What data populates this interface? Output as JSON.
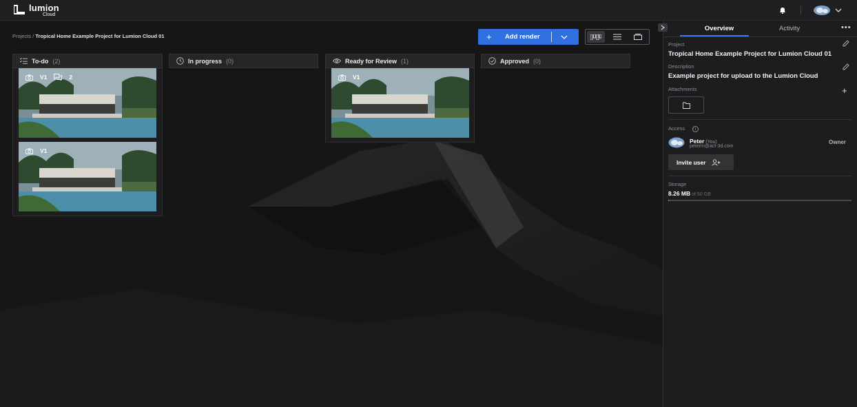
{
  "app": {
    "logo_text": "lumion",
    "logo_sub": "Cloud"
  },
  "breadcrumb": {
    "root": "Projects",
    "separator": "/",
    "current": "Tropical Home Example Project for Lumion Cloud 01"
  },
  "toolbar": {
    "add_render_label": "Add render",
    "add_render_color": "#2f6fe0",
    "view_modes": [
      "kanban",
      "list",
      "cards"
    ],
    "active_view": "kanban"
  },
  "board": {
    "columns": [
      {
        "label": "To-do",
        "count": "(2)",
        "icon": "checklist-icon",
        "cards": [
          {
            "version": "V1",
            "comments": "2"
          },
          {
            "version": "V1",
            "comments": ""
          }
        ]
      },
      {
        "label": "In progress",
        "count": "(0)",
        "icon": "clock-icon",
        "cards": []
      },
      {
        "label": "Ready for Review",
        "count": "(1)",
        "icon": "eye-icon",
        "cards": [
          {
            "version": "V1",
            "comments": ""
          }
        ]
      },
      {
        "label": "Approved",
        "count": "(0)",
        "icon": "check-circle-icon",
        "cards": []
      }
    ]
  },
  "panel": {
    "tabs": {
      "overview": "Overview",
      "activity": "Activity"
    },
    "project_label": "Project",
    "project_value": "Tropical Home Example Project for Lumion Cloud 01",
    "description_label": "Description",
    "description_value": "Example project for upload to the Lumion Cloud",
    "attachments_label": "Attachments",
    "access_label": "Access",
    "user": {
      "name": "Peter",
      "you": "(You)",
      "email": "peterm@act-3d.com",
      "role": "Owner"
    },
    "invite_label": "Invite user",
    "storage_label": "Storage",
    "storage_used": "8.26 MB",
    "storage_total": "of 50 GB",
    "storage_fraction": 0.0002,
    "accent_color": "#3a7af0"
  }
}
